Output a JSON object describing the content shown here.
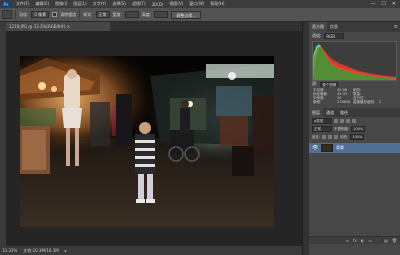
{
  "app": {
    "logo": "Ps",
    "window_controls": [
      "—",
      "☐",
      "✕"
    ]
  },
  "menu": [
    "文件(F)",
    "编辑(E)",
    "图像(I)",
    "图层(L)",
    "文字(Y)",
    "选择(S)",
    "滤镜(T)",
    "3D(D)",
    "视图(V)",
    "窗口(W)",
    "帮助(H)"
  ],
  "options": {
    "feather_label": "羽化:",
    "feather_value": "0 像素",
    "antialias_label": "消除锯齿",
    "style_label": "样式:",
    "style_value": "正常",
    "width_label": "宽度:",
    "height_label": "高度:",
    "refine_edge": "调整边缘..."
  },
  "document": {
    "tab_label": "1219.JPG @ 33.3%(RGB/8#) ×"
  },
  "status": {
    "zoom": "33.33%",
    "doc_info": "文档:10.3M/10.3M",
    "arrow": "▸"
  },
  "histogram": {
    "tabs": [
      "直方图",
      "信息"
    ],
    "channel_label": "通道:",
    "channel_value": "RGB",
    "source_label": "源:",
    "source_value": "整个图像",
    "stats": [
      [
        "平均值:",
        "42.98",
        "色阶:",
        ""
      ],
      [
        "标准偏差:",
        "44.33",
        "数量:",
        ""
      ],
      [
        "中间值:",
        "29",
        "百分位:",
        ""
      ],
      [
        "像素:",
        "278656",
        "高速缓存级别:",
        "2"
      ]
    ]
  },
  "layers": {
    "tabs": [
      "图层",
      "通道",
      "路径"
    ],
    "kind_label": "ρ类型",
    "blend_mode": "正常",
    "opacity_label": "不透明度:",
    "opacity_value": "100%",
    "lock_label": "锁定:",
    "fill_label": "填充:",
    "fill_value": "100%",
    "items": [
      {
        "name": "背景",
        "visible": true,
        "selected": true
      }
    ],
    "footer_icons": [
      "∞",
      "fx",
      "◐",
      "▭",
      "🗀",
      "▤",
      "🗑"
    ]
  },
  "colors": {
    "accent_selected": "#4f6f94",
    "panel": "#474747",
    "canvas_bg": "#252525"
  }
}
